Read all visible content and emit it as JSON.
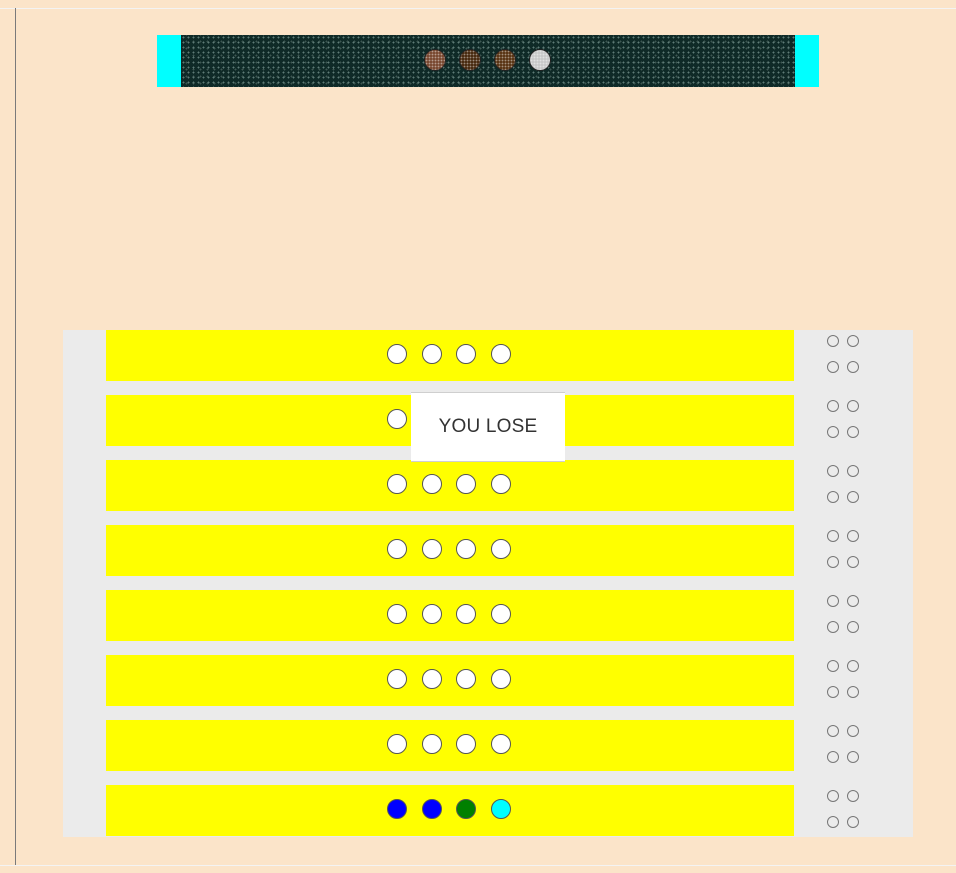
{
  "result_message": "YOU LOSE",
  "colors": {
    "background": "#fbe4c9",
    "board": "#ebebeb",
    "row": "#ffff00",
    "secret_cap": "#00ffff",
    "secret_panel": "#0f2a27"
  },
  "secret_code": [
    {
      "color": "#7a4a32"
    },
    {
      "color": "#4a2c12"
    },
    {
      "color": "#5b3616"
    },
    {
      "color": "#c9c9c9"
    }
  ],
  "rows": [
    {
      "pegs": [
        "#ffffff",
        "#ffffff",
        "#ffffff",
        "#ffffff"
      ],
      "feedback": [
        "empty",
        "empty",
        "empty",
        "empty"
      ]
    },
    {
      "pegs": [
        "#ffffff",
        "#ffffff",
        "#ffffff",
        "#ffffff"
      ],
      "feedback": [
        "empty",
        "empty",
        "empty",
        "empty"
      ]
    },
    {
      "pegs": [
        "#ffffff",
        "#ffffff",
        "#ffffff",
        "#ffffff"
      ],
      "feedback": [
        "empty",
        "empty",
        "empty",
        "empty"
      ]
    },
    {
      "pegs": [
        "#ffffff",
        "#ffffff",
        "#ffffff",
        "#ffffff"
      ],
      "feedback": [
        "empty",
        "empty",
        "empty",
        "empty"
      ]
    },
    {
      "pegs": [
        "#ffffff",
        "#ffffff",
        "#ffffff",
        "#ffffff"
      ],
      "feedback": [
        "empty",
        "empty",
        "empty",
        "empty"
      ]
    },
    {
      "pegs": [
        "#ffffff",
        "#ffffff",
        "#ffffff",
        "#ffffff"
      ],
      "feedback": [
        "empty",
        "empty",
        "empty",
        "empty"
      ]
    },
    {
      "pegs": [
        "#ffffff",
        "#ffffff",
        "#ffffff",
        "#ffffff"
      ],
      "feedback": [
        "empty",
        "empty",
        "empty",
        "empty"
      ]
    },
    {
      "pegs": [
        "#0000ff",
        "#0000ff",
        "#008000",
        "#00ffff"
      ],
      "feedback": [
        "empty",
        "empty",
        "empty",
        "empty"
      ]
    }
  ]
}
